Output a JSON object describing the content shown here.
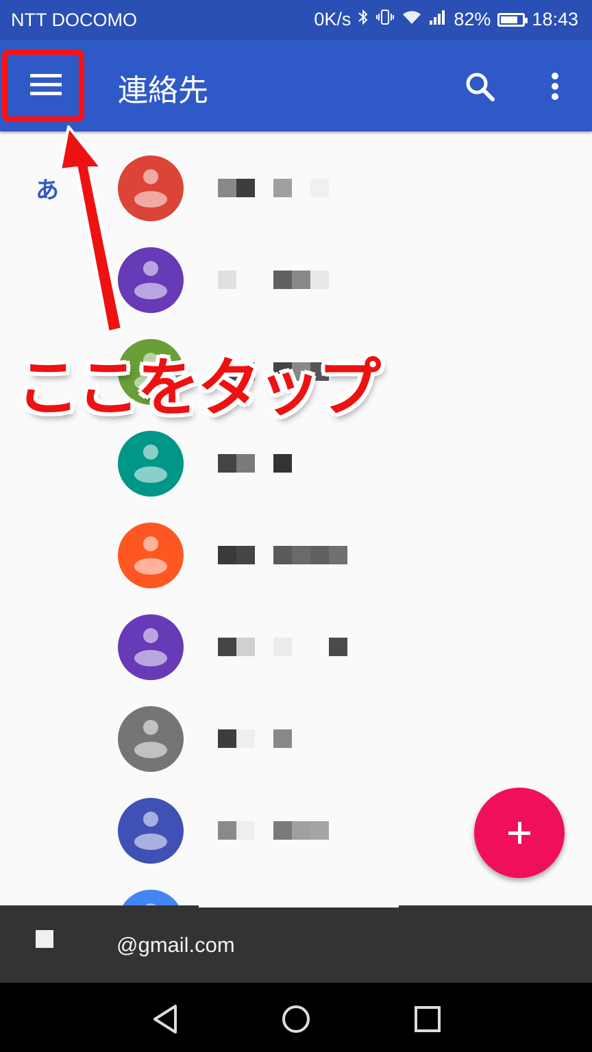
{
  "status_bar": {
    "carrier": "NTT DOCOMO",
    "speed": "0K/s",
    "battery": "82%",
    "time": "18:43",
    "icons": [
      "bluetooth-icon",
      "vibrate-icon",
      "wifi-icon",
      "signal-icon",
      "battery-icon"
    ]
  },
  "app_bar": {
    "title": "連絡先",
    "icons": [
      "menu-icon",
      "search-icon",
      "more-vert-icon"
    ],
    "color": "#2f59c6"
  },
  "contacts": {
    "section_letter": "あ",
    "avatar_colors": [
      "#db4437",
      "#673ab7",
      "#689f38",
      "#009688",
      "#ff5722",
      "#673ab7",
      "#757575",
      "#3f51b5",
      "#4285f4"
    ]
  },
  "annotation": {
    "text": "ここをタップ",
    "color": "#ee1111"
  },
  "fab": {
    "icon": "plus-icon",
    "color": "#f0105a"
  },
  "account_bar": {
    "email": "@gmail.com"
  },
  "nav_bar": {
    "icons": [
      "back-icon",
      "home-icon",
      "recents-icon"
    ]
  }
}
